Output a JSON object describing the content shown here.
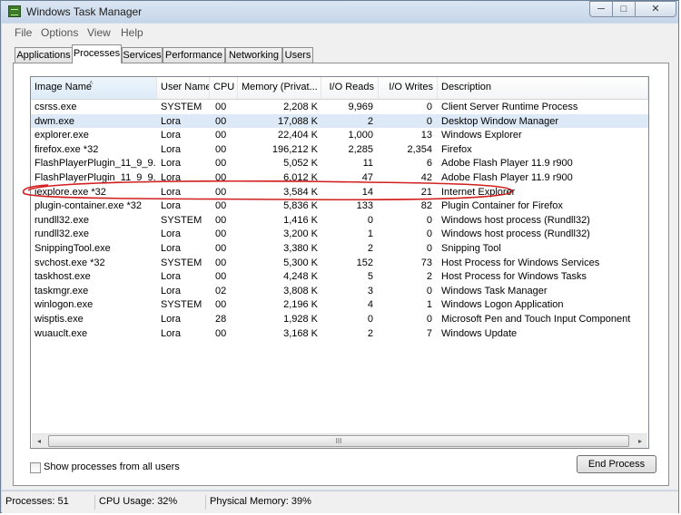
{
  "window": {
    "title": "Windows Task Manager",
    "min_symbol": "─",
    "max_symbol": "□",
    "close_symbol": "✕"
  },
  "menu": [
    "File",
    "Options",
    "View",
    "Help"
  ],
  "tabs": [
    "Applications",
    "Processes",
    "Services",
    "Performance",
    "Networking",
    "Users"
  ],
  "active_tab": "Processes",
  "columns": [
    "Image Name",
    "User Name",
    "CPU",
    "Memory (Privat...",
    "I/O Reads",
    "I/O Writes",
    "Description"
  ],
  "sort_indicator": "˄",
  "processes": [
    {
      "name": "csrss.exe",
      "user": "SYSTEM",
      "cpu": "00",
      "memory": "2,208 K",
      "io_reads": "9,969",
      "io_writes": "0",
      "description": "Client Server Runtime Process"
    },
    {
      "name": "dwm.exe",
      "user": "Lora",
      "cpu": "00",
      "memory": "17,088 K",
      "io_reads": "2",
      "io_writes": "0",
      "description": "Desktop Window Manager"
    },
    {
      "name": "explorer.exe",
      "user": "Lora",
      "cpu": "00",
      "memory": "22,404 K",
      "io_reads": "1,000",
      "io_writes": "13",
      "description": "Windows Explorer"
    },
    {
      "name": "firefox.exe *32",
      "user": "Lora",
      "cpu": "00",
      "memory": "196,212 K",
      "io_reads": "2,285",
      "io_writes": "2,354",
      "description": "Firefox"
    },
    {
      "name": "FlashPlayerPlugin_11_9_9...",
      "user": "Lora",
      "cpu": "00",
      "memory": "5,052 K",
      "io_reads": "11",
      "io_writes": "6",
      "description": "Adobe Flash Player 11.9 r900"
    },
    {
      "name": "FlashPlayerPlugin_11_9_9...",
      "user": "Lora",
      "cpu": "00",
      "memory": "6,012 K",
      "io_reads": "47",
      "io_writes": "42",
      "description": "Adobe Flash Player 11.9 r900"
    },
    {
      "name": "iexplore.exe *32",
      "user": "Lora",
      "cpu": "00",
      "memory": "3,584 K",
      "io_reads": "14",
      "io_writes": "21",
      "description": "Internet Explorer"
    },
    {
      "name": "plugin-container.exe *32",
      "user": "Lora",
      "cpu": "00",
      "memory": "5,836 K",
      "io_reads": "133",
      "io_writes": "82",
      "description": "Plugin Container for Firefox"
    },
    {
      "name": "rundll32.exe",
      "user": "SYSTEM",
      "cpu": "00",
      "memory": "1,416 K",
      "io_reads": "0",
      "io_writes": "0",
      "description": "Windows host process (Rundll32)"
    },
    {
      "name": "rundll32.exe",
      "user": "Lora",
      "cpu": "00",
      "memory": "3,200 K",
      "io_reads": "1",
      "io_writes": "0",
      "description": "Windows host process (Rundll32)"
    },
    {
      "name": "SnippingTool.exe",
      "user": "Lora",
      "cpu": "00",
      "memory": "3,380 K",
      "io_reads": "2",
      "io_writes": "0",
      "description": "Snipping Tool"
    },
    {
      "name": "svchost.exe *32",
      "user": "SYSTEM",
      "cpu": "00",
      "memory": "5,300 K",
      "io_reads": "152",
      "io_writes": "73",
      "description": "Host Process for Windows Services"
    },
    {
      "name": "taskhost.exe",
      "user": "Lora",
      "cpu": "00",
      "memory": "4,248 K",
      "io_reads": "5",
      "io_writes": "2",
      "description": "Host Process for Windows Tasks"
    },
    {
      "name": "taskmgr.exe",
      "user": "Lora",
      "cpu": "02",
      "memory": "3,808 K",
      "io_reads": "3",
      "io_writes": "0",
      "description": "Windows Task Manager"
    },
    {
      "name": "winlogon.exe",
      "user": "SYSTEM",
      "cpu": "00",
      "memory": "2,196 K",
      "io_reads": "4",
      "io_writes": "1",
      "description": "Windows Logon Application"
    },
    {
      "name": "wisptis.exe",
      "user": "Lora",
      "cpu": "28",
      "memory": "1,928 K",
      "io_reads": "0",
      "io_writes": "0",
      "description": "Microsoft Pen and Touch Input Component"
    },
    {
      "name": "wuauclt.exe",
      "user": "Lora",
      "cpu": "00",
      "memory": "3,168 K",
      "io_reads": "2",
      "io_writes": "7",
      "description": "Windows Update"
    }
  ],
  "selected_process": "dwm.exe",
  "highlighted_process": "iexplore.exe *32",
  "scrollbar": {
    "left_arrow": "◂",
    "right_arrow": "▸",
    "grip": "III"
  },
  "show_all_label": "Show processes from all users",
  "show_all_checked": false,
  "end_process_label": "End Process",
  "status": {
    "processes": "Processes: 51",
    "cpu_usage": "CPU Usage: 32%",
    "physical_memory": "Physical Memory: 39%"
  },
  "colors": {
    "selection": "#dde9f7",
    "annotation": "#d21f1f",
    "frame": "#cfdcec"
  }
}
